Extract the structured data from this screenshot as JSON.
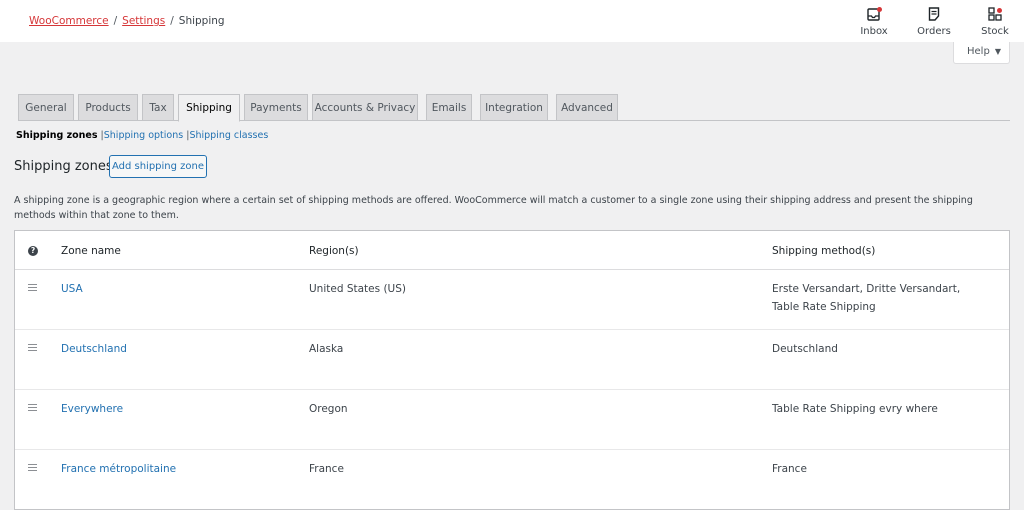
{
  "breadcrumb": {
    "woocommerce": "WooCommerce",
    "settings": "Settings",
    "current": "Shipping",
    "sep": "/"
  },
  "top_actions": {
    "inbox": "Inbox",
    "orders": "Orders",
    "stock": "Stock"
  },
  "help": {
    "label": "Help",
    "caret": "▼"
  },
  "tabs": [
    "General",
    "Products",
    "Tax",
    "Shipping",
    "Payments",
    "Accounts & Privacy",
    "Emails",
    "Integration",
    "Advanced"
  ],
  "active_tab": "Shipping",
  "subsub": {
    "zones": "Shipping zones",
    "options": "Shipping options",
    "classes": "Shipping classes",
    "sep": "|"
  },
  "section": {
    "title": "Shipping zones",
    "add_button": "Add shipping zone"
  },
  "description": "A shipping zone is a geographic region where a certain set of shipping methods are offered. WooCommerce will match a customer to a single zone using their shipping address and present the shipping methods within that zone to them.",
  "table": {
    "headers": {
      "help": "?",
      "name": "Zone name",
      "region": "Region(s)",
      "method": "Shipping method(s)"
    },
    "rows": [
      {
        "name": "USA",
        "region": "United States (US)",
        "method": "Erste Versandart, Dritte Versandart, Table Rate Shipping"
      },
      {
        "name": "Deutschland",
        "region": "Alaska",
        "method": "Deutschland"
      },
      {
        "name": "Everywhere",
        "region": "Oregon",
        "method": "Table Rate Shipping evry where"
      },
      {
        "name": "France métropolitaine",
        "region": "France",
        "method": "France"
      }
    ]
  },
  "colors": {
    "link": "#2271b1",
    "breadcrumb_link": "#d63638",
    "notification_dot": "#d63638"
  }
}
